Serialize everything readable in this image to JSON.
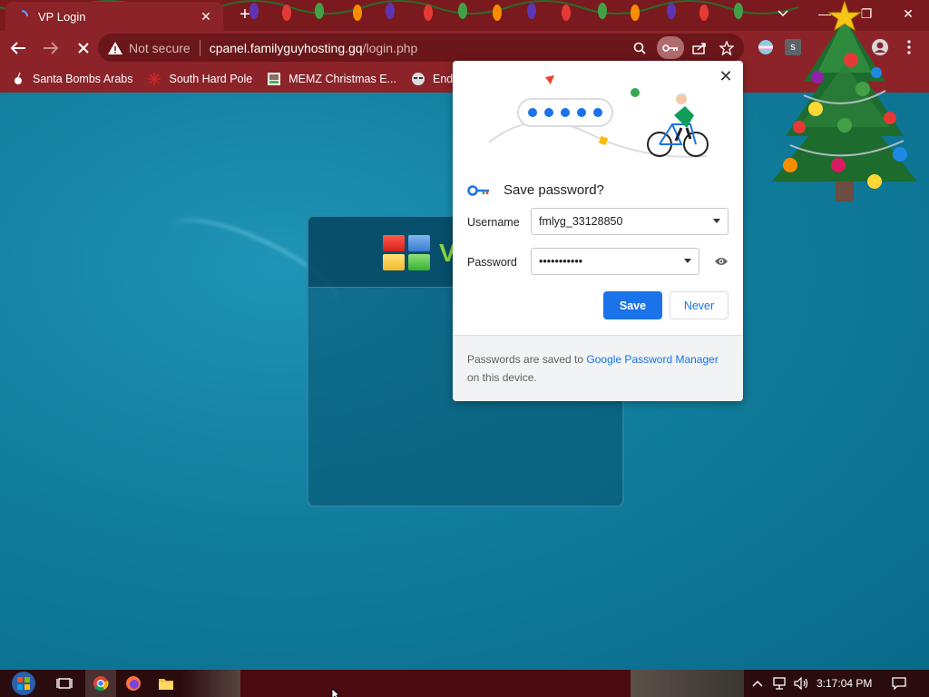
{
  "browser": {
    "tab": {
      "title": "VP Login"
    },
    "omnibox": {
      "security_label": "Not secure",
      "url_host": "cpanel.familyguyhosting.gq",
      "url_path": "/login.php"
    },
    "bookmarks": [
      {
        "label": "Santa Bombs Arabs",
        "icon": "bomb-icon"
      },
      {
        "label": "South Hard Pole",
        "icon": "snowflake-icon"
      },
      {
        "label": "MEMZ Christmas E...",
        "icon": "memz-icon"
      },
      {
        "label": "Enderma",
        "icon": "enderman-icon"
      }
    ]
  },
  "page": {
    "logo_letter": "V"
  },
  "save_password": {
    "title": "Save password?",
    "username_label": "Username",
    "username_value": "fmlyg_33128850",
    "password_label": "Password",
    "password_value": "•••••••••••",
    "save_label": "Save",
    "never_label": "Never",
    "footer_prefix": "Passwords are saved to ",
    "footer_link": "Google Password Manager",
    "footer_suffix": " on this device.",
    "close_label": "✕"
  },
  "taskbar": {
    "clock": "3:17:04 PM"
  },
  "colors": {
    "accent": "#1a73e8",
    "chrome_frame": "#8c2328",
    "page_bg": "#0d6f92"
  }
}
